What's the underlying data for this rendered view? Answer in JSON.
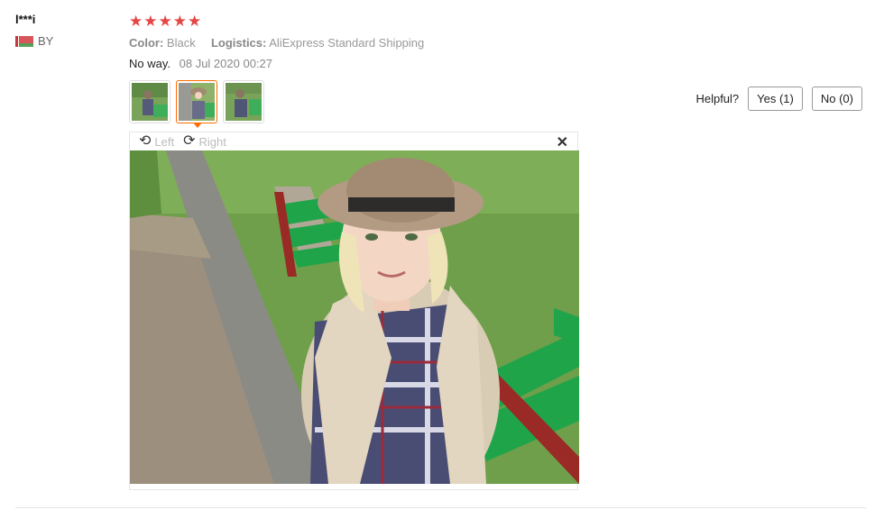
{
  "user": {
    "name": "l***i",
    "country": "BY"
  },
  "review": {
    "rating_stars": 5,
    "color_label": "Color:",
    "color_value": "Black",
    "logistics_label": "Logistics:",
    "logistics_value": "AliExpress Standard Shipping",
    "text": "No way.",
    "date": "08 Jul 2020 00:27"
  },
  "viewer": {
    "rotate_left": "Left",
    "rotate_right": "Right",
    "close_symbol": "✕"
  },
  "helpful": {
    "label": "Helpful?",
    "yes": "Yes (1)",
    "no": "No (0)"
  },
  "colors": {
    "star": "#e64545",
    "active_thumb": "#ff6a00"
  }
}
